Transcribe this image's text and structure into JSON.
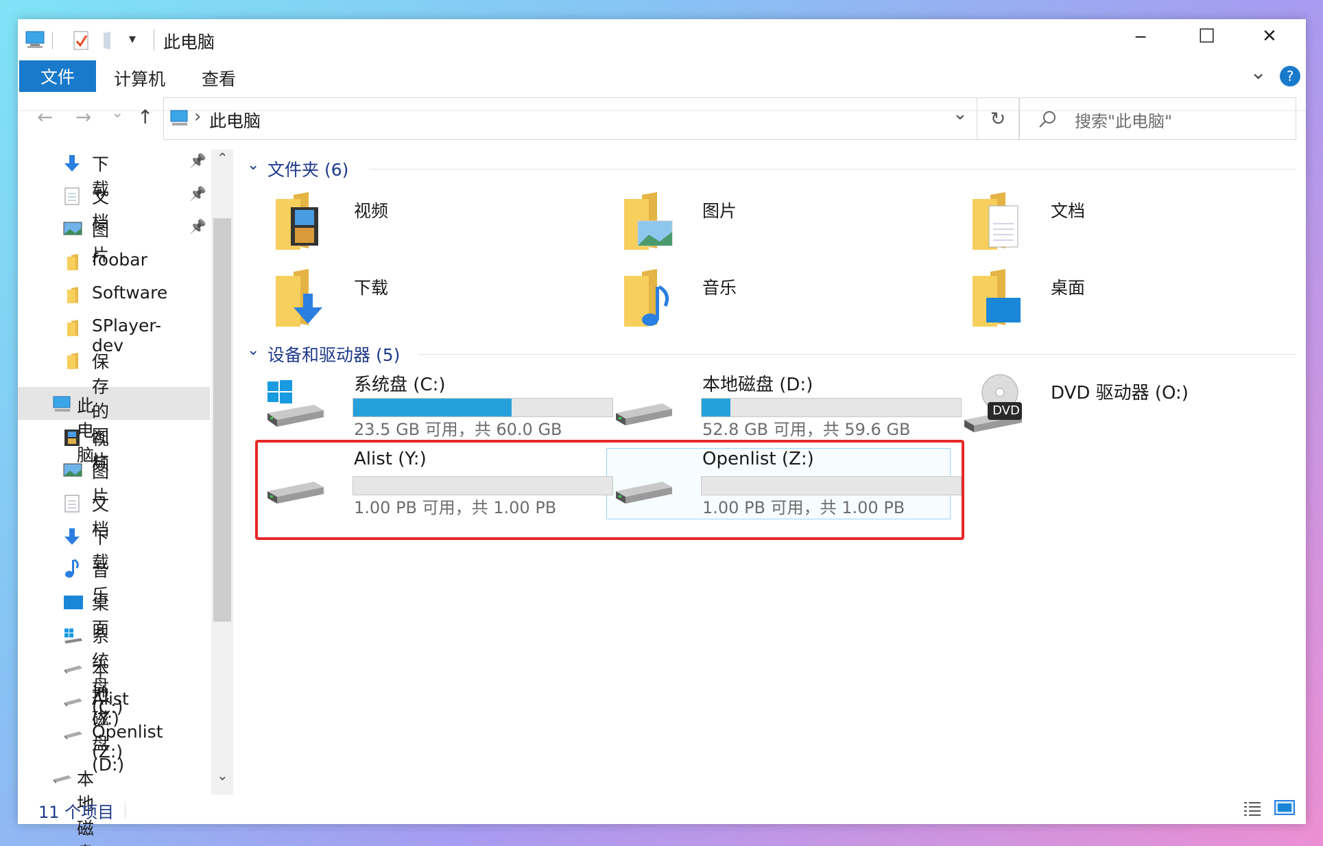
{
  "window": {
    "title": "此电脑",
    "minimize": "─",
    "maximize": "☐",
    "close": "✕"
  },
  "quick_access": {
    "dropdown": "▾"
  },
  "ribbon": {
    "tabs": [
      "文件",
      "计算机",
      "查看"
    ],
    "collapse": "⌄",
    "help": "?"
  },
  "nav": {
    "back": "←",
    "forward": "→",
    "recent": "⌄",
    "up": "↑"
  },
  "address": {
    "path": "此电脑",
    "sep": "›",
    "dropdown": "⌄",
    "refresh": "↻"
  },
  "search": {
    "placeholder": "搜索\"此电脑\""
  },
  "sidebar": {
    "pinned": [
      {
        "label": "下载",
        "icon": "download-icon"
      },
      {
        "label": "文档",
        "icon": "document-icon"
      },
      {
        "label": "图片",
        "icon": "picture-icon"
      }
    ],
    "folders": [
      "foobar",
      "Software",
      "SPlayer-dev",
      "保存的图片"
    ],
    "this_pc": "此电脑",
    "pc_items": [
      {
        "label": "视频",
        "icon": "video-icon"
      },
      {
        "label": "图片",
        "icon": "picture-icon"
      },
      {
        "label": "文档",
        "icon": "document-icon"
      },
      {
        "label": "下载",
        "icon": "download-icon"
      },
      {
        "label": "音乐",
        "icon": "music-icon"
      },
      {
        "label": "桌面",
        "icon": "desktop-icon"
      }
    ],
    "drives": [
      "系统盘 (C:)",
      "本地磁盘 (D:)",
      "Alist (Y:)",
      "Openlist (Z:)"
    ],
    "network_drive": "本地磁盘 (D:)",
    "pin": "📌",
    "scroll_up": "⌃",
    "scroll_down": "⌄"
  },
  "content": {
    "folders_header": "文件夹 (6)",
    "folders": [
      "视频",
      "图片",
      "文档",
      "下载",
      "音乐",
      "桌面"
    ],
    "drives_header": "设备和驱动器 (5)",
    "chevron": "⌄",
    "drives": [
      {
        "name": "系统盘 (C:)",
        "free": "23.5 GB 可用，共 60.0 GB",
        "used_fraction": 0.61
      },
      {
        "name": "本地磁盘 (D:)",
        "free": "52.8 GB 可用，共 59.6 GB",
        "used_fraction": 0.11
      },
      {
        "name": "DVD 驱动器 (O:)",
        "badge": "DVD"
      },
      {
        "name": "Alist (Y:)",
        "free": "1.00 PB 可用，共 1.00 PB",
        "used_fraction": 0
      },
      {
        "name": "Openlist (Z:)",
        "free": "1.00 PB 可用，共 1.00 PB",
        "used_fraction": 0
      }
    ]
  },
  "status": {
    "count": "11 个项目"
  },
  "colors": {
    "accent": "#1979ca",
    "bar": "#26a0da",
    "highlight": "#e62828",
    "folder": "#f6cf5d"
  }
}
